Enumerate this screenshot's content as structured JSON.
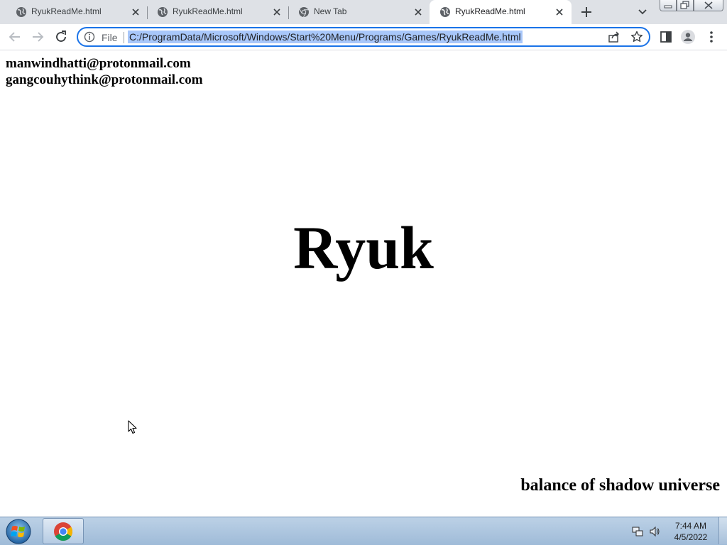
{
  "browser": {
    "tabs": [
      {
        "title": "RyukReadMe.html",
        "icon": "globe-icon",
        "active": false
      },
      {
        "title": "RyukReadMe.html",
        "icon": "globe-icon",
        "active": false
      },
      {
        "title": "New Tab",
        "icon": "chrome-icon",
        "active": false
      },
      {
        "title": "RyukReadMe.html",
        "icon": "globe-icon",
        "active": true
      }
    ],
    "address_bar": {
      "security_chip": "File",
      "url": "C:/ProgramData/Microsoft/Windows/Start%20Menu/Programs/Games/RyukReadMe.html"
    }
  },
  "page": {
    "contacts": [
      "manwindhatti@protonmail.com",
      "gangcouhythink@protonmail.com"
    ],
    "title": "Ryuk",
    "footer": "balance of shadow universe"
  },
  "taskbar": {
    "time": "7:44 AM",
    "date": "4/5/2022"
  },
  "colors": {
    "tabstrip_bg": "#dee1e6",
    "omnibox_focus": "#1a73e8",
    "url_selection": "#a8c7fa",
    "taskbar_bg": "#aac3de"
  }
}
